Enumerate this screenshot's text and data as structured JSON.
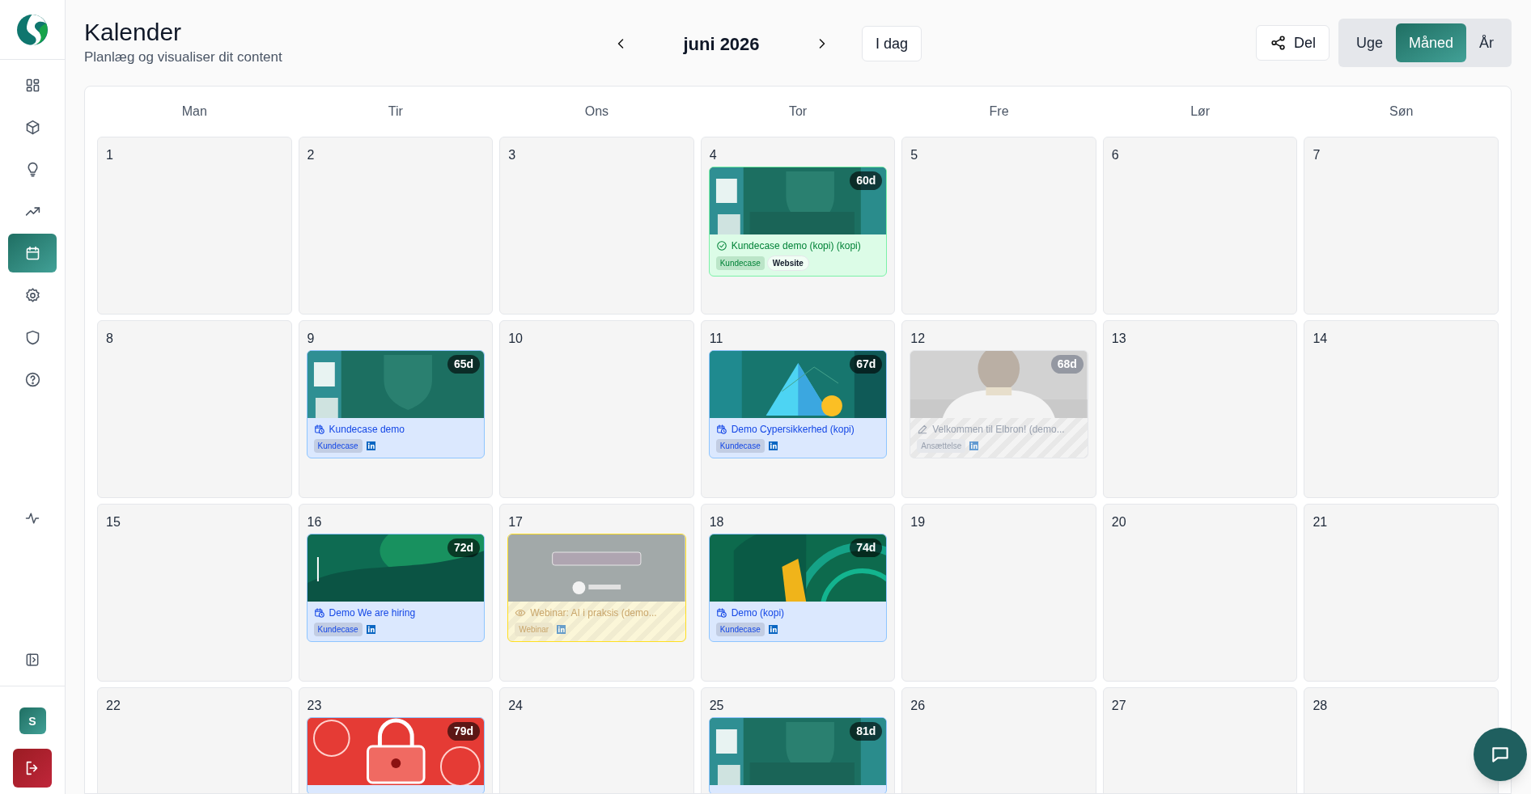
{
  "sidebar": {
    "nav": [
      {
        "selected": false
      },
      {
        "selected": false
      },
      {
        "selected": false
      },
      {
        "selected": false
      },
      {
        "selected": true
      },
      {
        "selected": false
      },
      {
        "selected": false
      },
      {
        "selected": false
      }
    ],
    "avatar": "S"
  },
  "header": {
    "title": "Kalender",
    "subtitle": "Planlæg og visualiser dit content",
    "month": "juni 2026",
    "today": "I dag",
    "share": "Del",
    "views": [
      {
        "label": "Uge",
        "selected": false
      },
      {
        "label": "Måned",
        "selected": true
      },
      {
        "label": "År",
        "selected": false
      }
    ]
  },
  "weekdays": [
    "Man",
    "Tir",
    "Ons",
    "Tor",
    "Fre",
    "Lør",
    "Søn"
  ],
  "weeks": [
    [
      {
        "day": "1"
      },
      {
        "day": "2"
      },
      {
        "day": "3"
      },
      {
        "day": "4",
        "events": [
          {
            "kind": "published",
            "age": "60d",
            "title": "Kundecase demo (kopi) (kopi)",
            "category": "Kundecase",
            "channel": {
              "kind": "text",
              "label": "Website"
            }
          }
        ]
      },
      {
        "day": "5"
      },
      {
        "day": "6"
      },
      {
        "day": "7"
      }
    ],
    [
      {
        "day": "8"
      },
      {
        "day": "9",
        "events": [
          {
            "kind": "scheduled",
            "age": "65d",
            "title": "Kundecase demo",
            "category": "Kundecase",
            "channel": {
              "kind": "linkedin"
            }
          }
        ]
      },
      {
        "day": "10"
      },
      {
        "day": "11",
        "events": [
          {
            "kind": "scheduled",
            "age": "67d",
            "title": "Demo Cypersikkerhed (kopi)",
            "category": "Kundecase",
            "channel": {
              "kind": "linkedin"
            }
          }
        ]
      },
      {
        "day": "12",
        "events": [
          {
            "kind": "draft",
            "age": "68d",
            "title": "Velkommen til Elbron! (demo...",
            "category": "Ansættelse",
            "channel": {
              "kind": "linkedin"
            }
          }
        ]
      },
      {
        "day": "13"
      },
      {
        "day": "14"
      }
    ],
    [
      {
        "day": "15"
      },
      {
        "day": "16",
        "events": [
          {
            "kind": "scheduled",
            "age": "72d",
            "title": "Demo We are hiring",
            "category": "Kundecase",
            "channel": {
              "kind": "linkedin"
            }
          }
        ]
      },
      {
        "day": "17",
        "events": [
          {
            "kind": "review",
            "title": "Webinar: AI i praksis (demo...",
            "category": "Webinar",
            "channel": {
              "kind": "linkedin"
            }
          }
        ]
      },
      {
        "day": "18",
        "events": [
          {
            "kind": "scheduled",
            "age": "74d",
            "title": "Demo (kopi)",
            "category": "Kundecase",
            "channel": {
              "kind": "linkedin"
            }
          }
        ]
      },
      {
        "day": "19"
      },
      {
        "day": "20"
      },
      {
        "day": "21"
      }
    ],
    [
      {
        "day": "22"
      },
      {
        "day": "23",
        "events": [
          {
            "kind": "scheduled",
            "age": "79d"
          }
        ]
      },
      {
        "day": "24"
      },
      {
        "day": "25",
        "events": [
          {
            "kind": "scheduled",
            "age": "81d"
          }
        ]
      },
      {
        "day": "26"
      },
      {
        "day": "27"
      },
      {
        "day": "28"
      }
    ]
  ]
}
